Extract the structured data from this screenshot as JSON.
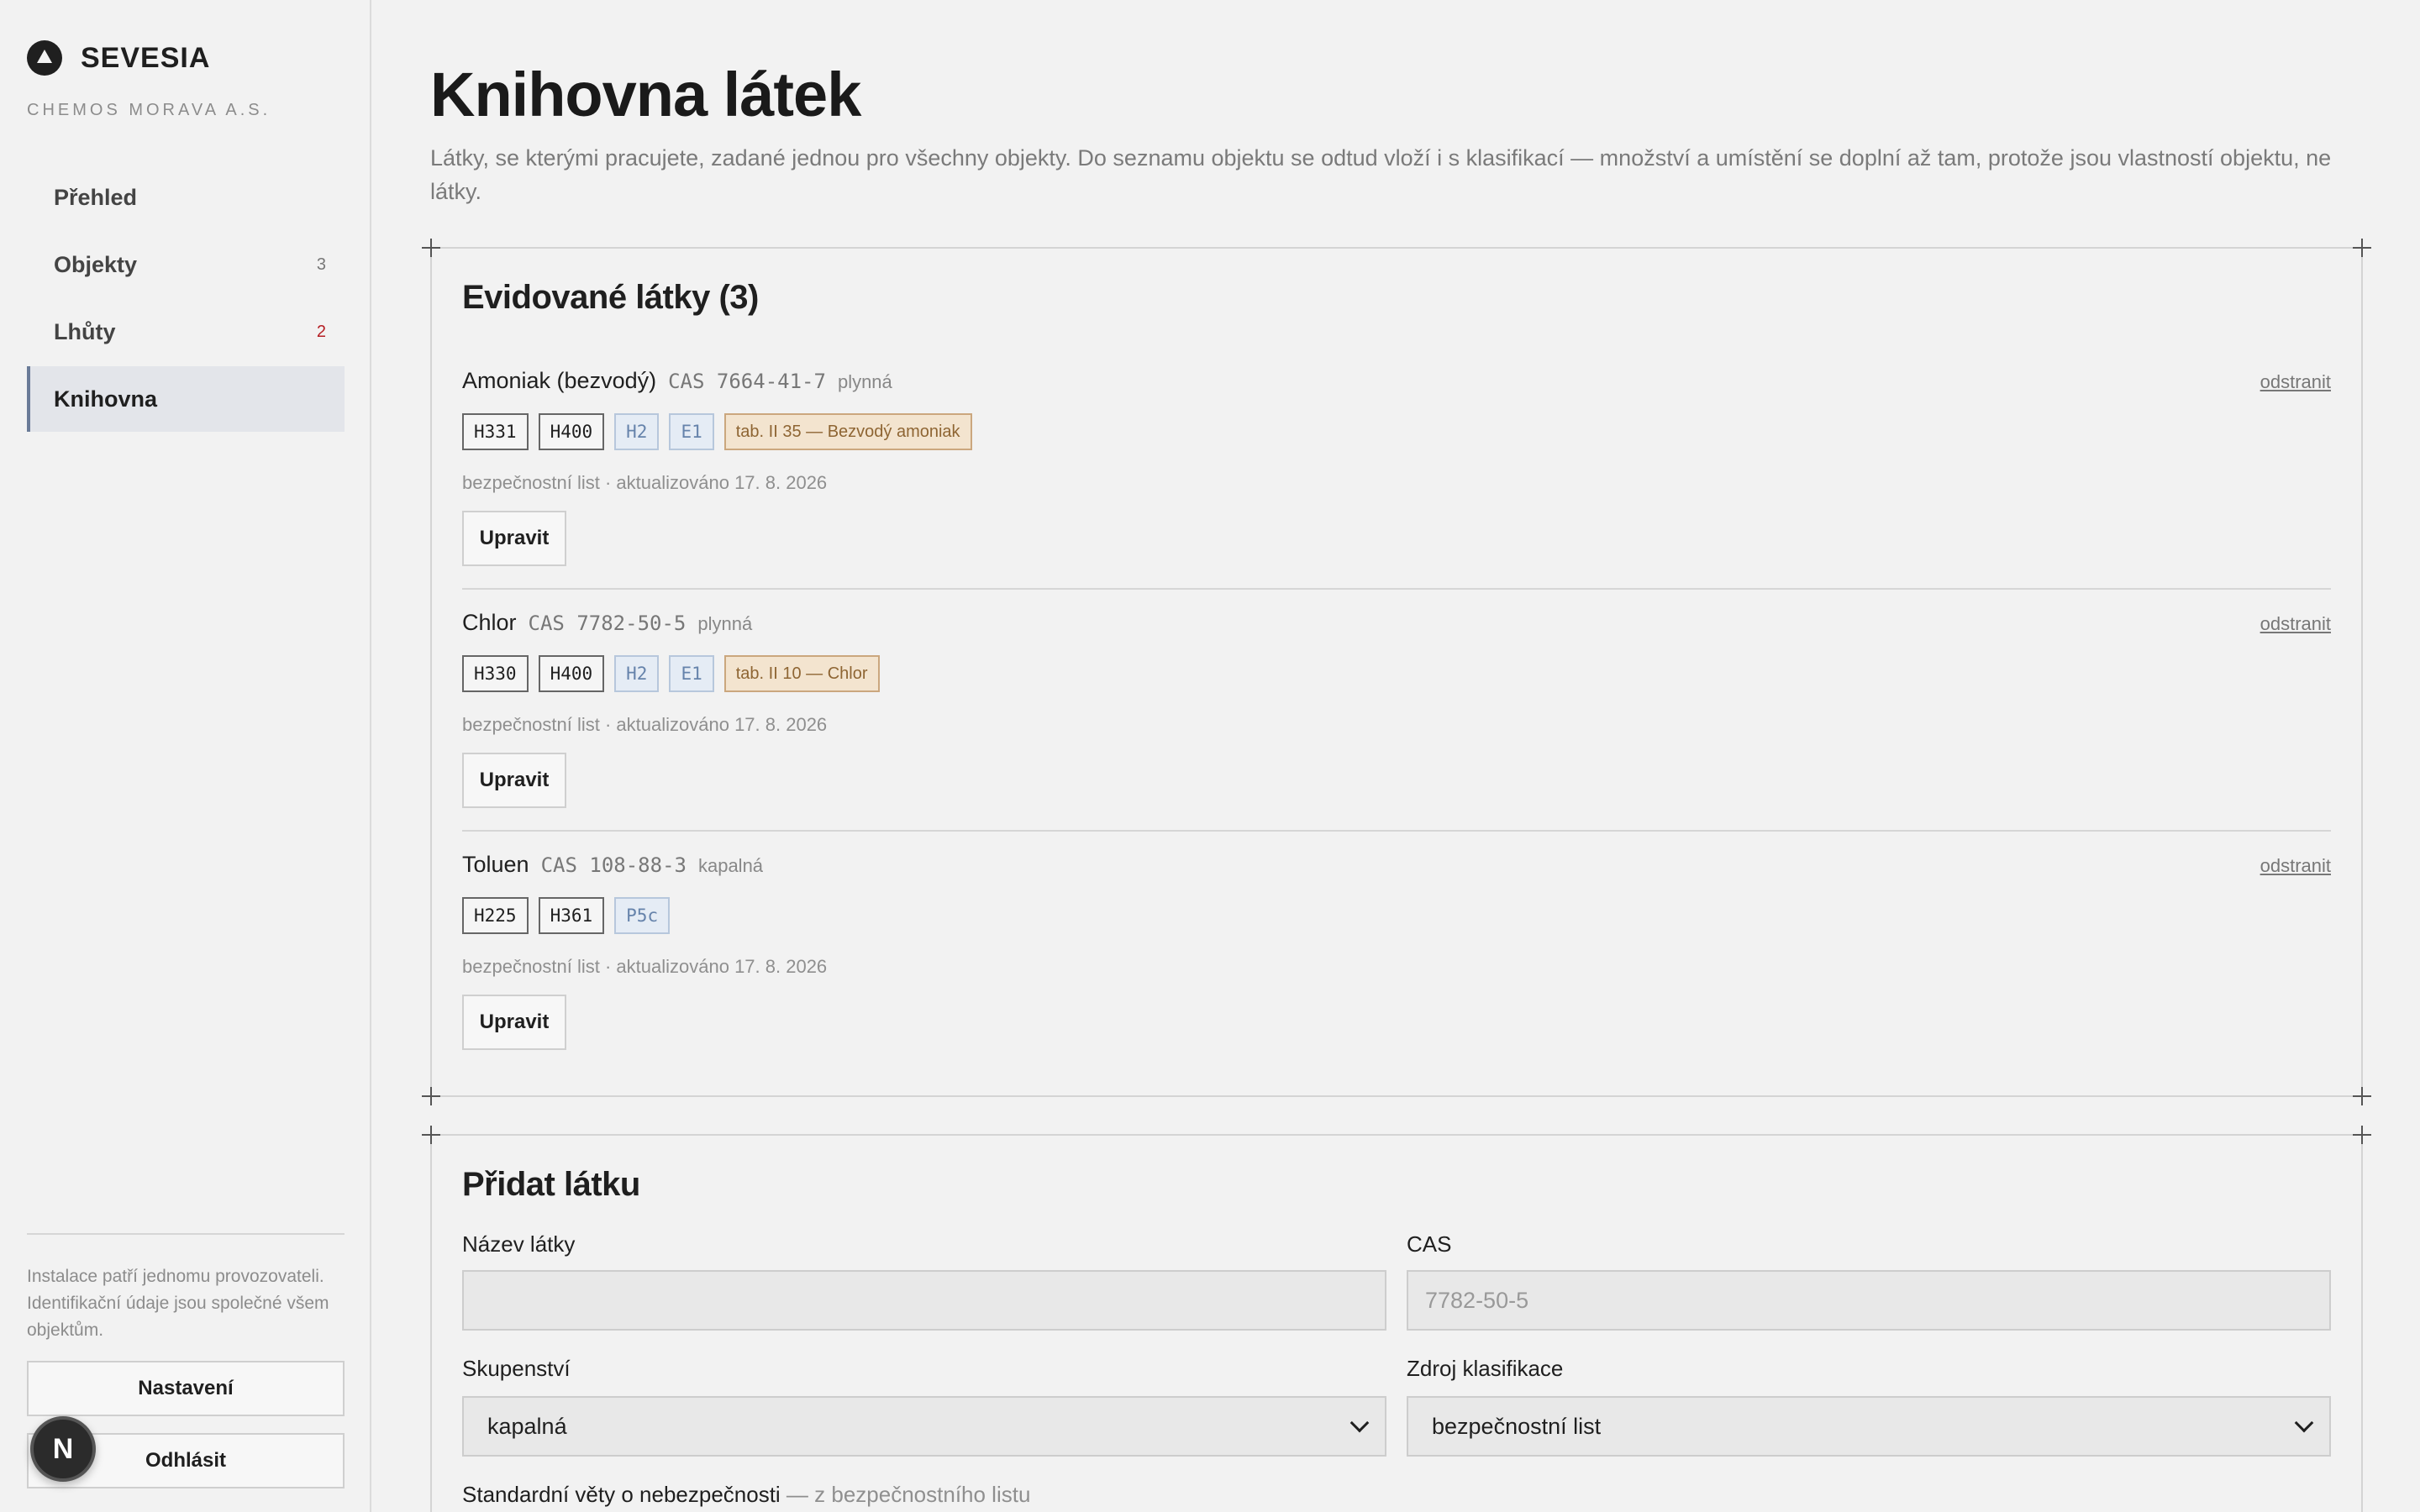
{
  "sidebar": {
    "brand": "SEVESIA",
    "organization": "CHEMOS MORAVA A.S.",
    "nav": [
      {
        "label": "Přehled",
        "count": ""
      },
      {
        "label": "Objekty",
        "count": "3"
      },
      {
        "label": "Lhůty",
        "count": "2"
      },
      {
        "label": "Knihovna",
        "count": ""
      }
    ],
    "note": "Instalace patří jednomu provozovateli. Identifikační údaje jsou společné všem objektům.",
    "settings_label": "Nastavení",
    "logout_label": "Odhlásit",
    "dev_badge": "N"
  },
  "page": {
    "title": "Knihovna látek",
    "description": "Látky, se kterými pracujete, zadané jednou pro všechny objekty. Do seznamu objektu se odtud vloží i s klasifikací — množství a umístění se doplní až tam, protože jsou vlastností objektu, ne látky."
  },
  "list": {
    "title": "Evidované látky (3)",
    "remove_label": "odstranit",
    "edit_label": "Upravit",
    "items": [
      {
        "name": "Amoniak (bezvodý)",
        "cas": "CAS 7664-41-7",
        "state": "plynná",
        "h_codes": [
          "H331",
          "H400"
        ],
        "categories": [
          "H2",
          "E1"
        ],
        "table_ref": "tab. II 35 — Bezvodý amoniak",
        "meta": "bezpečnostní list · aktualizováno 17. 8. 2026"
      },
      {
        "name": "Chlor",
        "cas": "CAS 7782-50-5",
        "state": "plynná",
        "h_codes": [
          "H330",
          "H400"
        ],
        "categories": [
          "H2",
          "E1"
        ],
        "table_ref": "tab. II 10 — Chlor",
        "meta": "bezpečnostní list · aktualizováno 17. 8. 2026"
      },
      {
        "name": "Toluen",
        "cas": "CAS 108-88-3",
        "state": "kapalná",
        "h_codes": [
          "H225",
          "H361"
        ],
        "categories": [
          "P5c"
        ],
        "table_ref": "",
        "meta": "bezpečnostní list · aktualizováno 17. 8. 2026"
      }
    ]
  },
  "form": {
    "title": "Přidat látku",
    "name_label": "Název látky",
    "name_value": "",
    "cas_label": "CAS",
    "cas_placeholder": "7782-50-5",
    "state_label": "Skupenství",
    "state_value": "kapalná",
    "source_label": "Zdroj klasifikace",
    "source_value": "bezpečnostní list",
    "h_label": "Standardní věty o nebezpečnosti",
    "h_hint": " — z bezpečnostního listu"
  }
}
